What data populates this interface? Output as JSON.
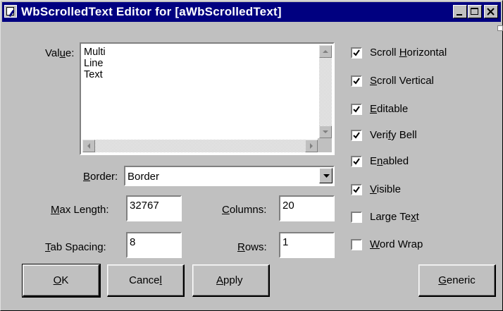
{
  "window": {
    "title": "WbScrolledText Editor for [aWbScrolledText]"
  },
  "value": {
    "label_pre": "Val",
    "label_u": "u",
    "label_post": "e:",
    "lines": [
      "Multi",
      "Line",
      "Text"
    ]
  },
  "border": {
    "label_pre": "",
    "label_u": "B",
    "label_post": "order:",
    "selected": "Border"
  },
  "max_length": {
    "label_pre": "",
    "label_u": "M",
    "label_post": "ax Length:",
    "value": "32767"
  },
  "tab_spacing": {
    "label_pre": "",
    "label_u": "T",
    "label_post": "ab Spacing:",
    "value": "8"
  },
  "columns": {
    "label_pre": "",
    "label_u": "C",
    "label_post": "olumns:",
    "value": "20"
  },
  "rows": {
    "label_pre": "",
    "label_u": "R",
    "label_post": "ows:",
    "value": "1"
  },
  "checkboxes": [
    {
      "pre": "Scroll ",
      "u": "H",
      "post": "orizontal",
      "checked": true
    },
    {
      "pre": "",
      "u": "S",
      "post": "croll Vertical",
      "checked": true
    },
    {
      "pre": "",
      "u": "E",
      "post": "ditable",
      "checked": true
    },
    {
      "pre": "Veri",
      "u": "f",
      "post": "y Bell",
      "checked": true
    },
    {
      "pre": "E",
      "u": "n",
      "post": "abled",
      "checked": true
    },
    {
      "pre": "",
      "u": "V",
      "post": "isible",
      "checked": true
    },
    {
      "pre": "Large Te",
      "u": "x",
      "post": "t",
      "checked": false
    },
    {
      "pre": "",
      "u": "W",
      "post": "ord Wrap",
      "checked": false
    }
  ],
  "buttons": {
    "ok": {
      "pre": "",
      "u": "O",
      "post": "K"
    },
    "cancel": {
      "pre": "Cance",
      "u": "l",
      "post": ""
    },
    "apply": {
      "pre": "",
      "u": "A",
      "post": "pply"
    },
    "generic": {
      "pre": "",
      "u": "G",
      "post": "eneric"
    }
  },
  "colors": {
    "face": "#c0c0c0",
    "title_bar": "#000080",
    "highlight": "#ffffff",
    "shadow": "#808080"
  },
  "icons": [
    "app-icon",
    "minimize-icon",
    "maximize-icon",
    "close-icon",
    "scroll-up-icon",
    "scroll-down-icon",
    "scroll-left-icon",
    "scroll-right-icon",
    "dropdown-arrow-icon",
    "checkmark-icon"
  ]
}
